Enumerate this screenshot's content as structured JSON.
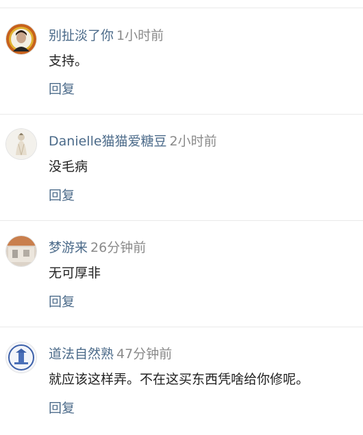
{
  "comments": [
    {
      "name": "别扯淡了你",
      "time": "1小时前",
      "content": "支持。",
      "reply_label": "回复",
      "avatar_icon": "portrait-avatar-icon"
    },
    {
      "name": "Danielle猫猫爱糖豆",
      "time": "2小时前",
      "content": "没毛病",
      "reply_label": "回复",
      "avatar_icon": "figure-avatar-icon"
    },
    {
      "name": "梦游来",
      "time": "26分钟前",
      "content": "无可厚非",
      "reply_label": "回复",
      "avatar_icon": "blurred-avatar-icon"
    },
    {
      "name": "道法自然熟",
      "time": "47分钟前",
      "content": "就应该这样弄。不在这买东西凭啥给你修呢。",
      "reply_label": "回复",
      "avatar_icon": "temple-avatar-icon"
    }
  ],
  "colors": {
    "name": "#4c6b8a",
    "time": "#8a8a8a",
    "content": "#222222",
    "reply": "#4c6b8a",
    "divider": "#e9e9e9"
  }
}
